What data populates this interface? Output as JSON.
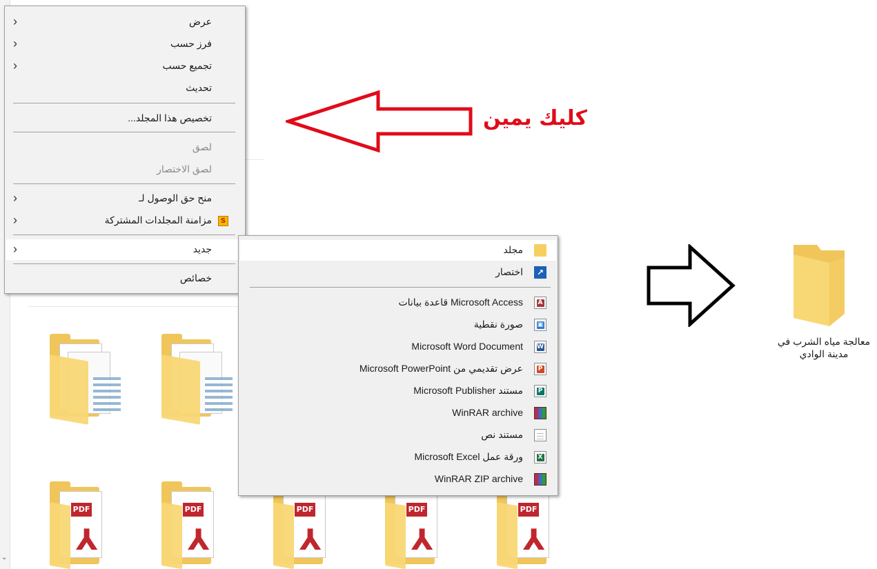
{
  "annotation": {
    "text": "كليك يمين",
    "color": "#e10b1a"
  },
  "context_menu": {
    "items": [
      {
        "label": "عرض",
        "submenu": true
      },
      {
        "label": "فرز حسب",
        "submenu": true
      },
      {
        "label": "تجميع حسب",
        "submenu": true
      },
      {
        "label": "تحديث",
        "submenu": false
      },
      {
        "label": "تخصيص هذا المجلد...",
        "submenu": false
      },
      {
        "label": "لصق",
        "submenu": false,
        "disabled": true
      },
      {
        "label": "لصق الاختصار",
        "submenu": false,
        "disabled": true
      },
      {
        "label": "منح حق الوصول لـ",
        "submenu": true
      },
      {
        "label": "مزامنة المجلدات المشتركة",
        "submenu": true,
        "icon": "sync-icon",
        "icon_glyph": "S"
      },
      {
        "label": "جديد",
        "submenu": true,
        "highlighted": true
      },
      {
        "label": "خصائص",
        "submenu": false
      }
    ]
  },
  "new_submenu": {
    "items": [
      {
        "label": "مجلد",
        "icon": "folder-icon",
        "highlighted": true
      },
      {
        "label": "اختصار",
        "icon": "shortcut-icon",
        "icon_glyph": "↗"
      },
      {
        "label": "Microsoft Access قاعدة بيانات",
        "icon": "access-icon",
        "icon_glyph": "A",
        "color": "#a4373a"
      },
      {
        "label": "صورة نقطية",
        "icon": "bitmap-icon",
        "icon_glyph": "▣",
        "color": "#2b7cd3"
      },
      {
        "label": "Microsoft Word Document",
        "icon": "word-icon",
        "icon_glyph": "W",
        "color": "#2b579a"
      },
      {
        "label": "عرض تقديمي من Microsoft PowerPoint",
        "icon": "powerpoint-icon",
        "icon_glyph": "P",
        "color": "#d24726"
      },
      {
        "label": "مستند Microsoft Publisher",
        "icon": "publisher-icon",
        "icon_glyph": "P",
        "color": "#077568"
      },
      {
        "label": "WinRAR archive",
        "icon": "winrar-icon"
      },
      {
        "label": "مستند نص",
        "icon": "text-document-icon"
      },
      {
        "label": "ورقة عمل Microsoft Excel",
        "icon": "excel-icon",
        "icon_glyph": "X",
        "color": "#217346"
      },
      {
        "label": "WinRAR ZIP archive",
        "icon": "winrar-zip-icon"
      }
    ]
  },
  "desktop_folder": {
    "name": "معالجة مياه الشرب في مدينة الوادي"
  },
  "glyphs": {
    "submenu_arrow": "‹",
    "pdf": "⅄",
    "pdf_badge": "PDF",
    "scroll_down": "⌄"
  }
}
